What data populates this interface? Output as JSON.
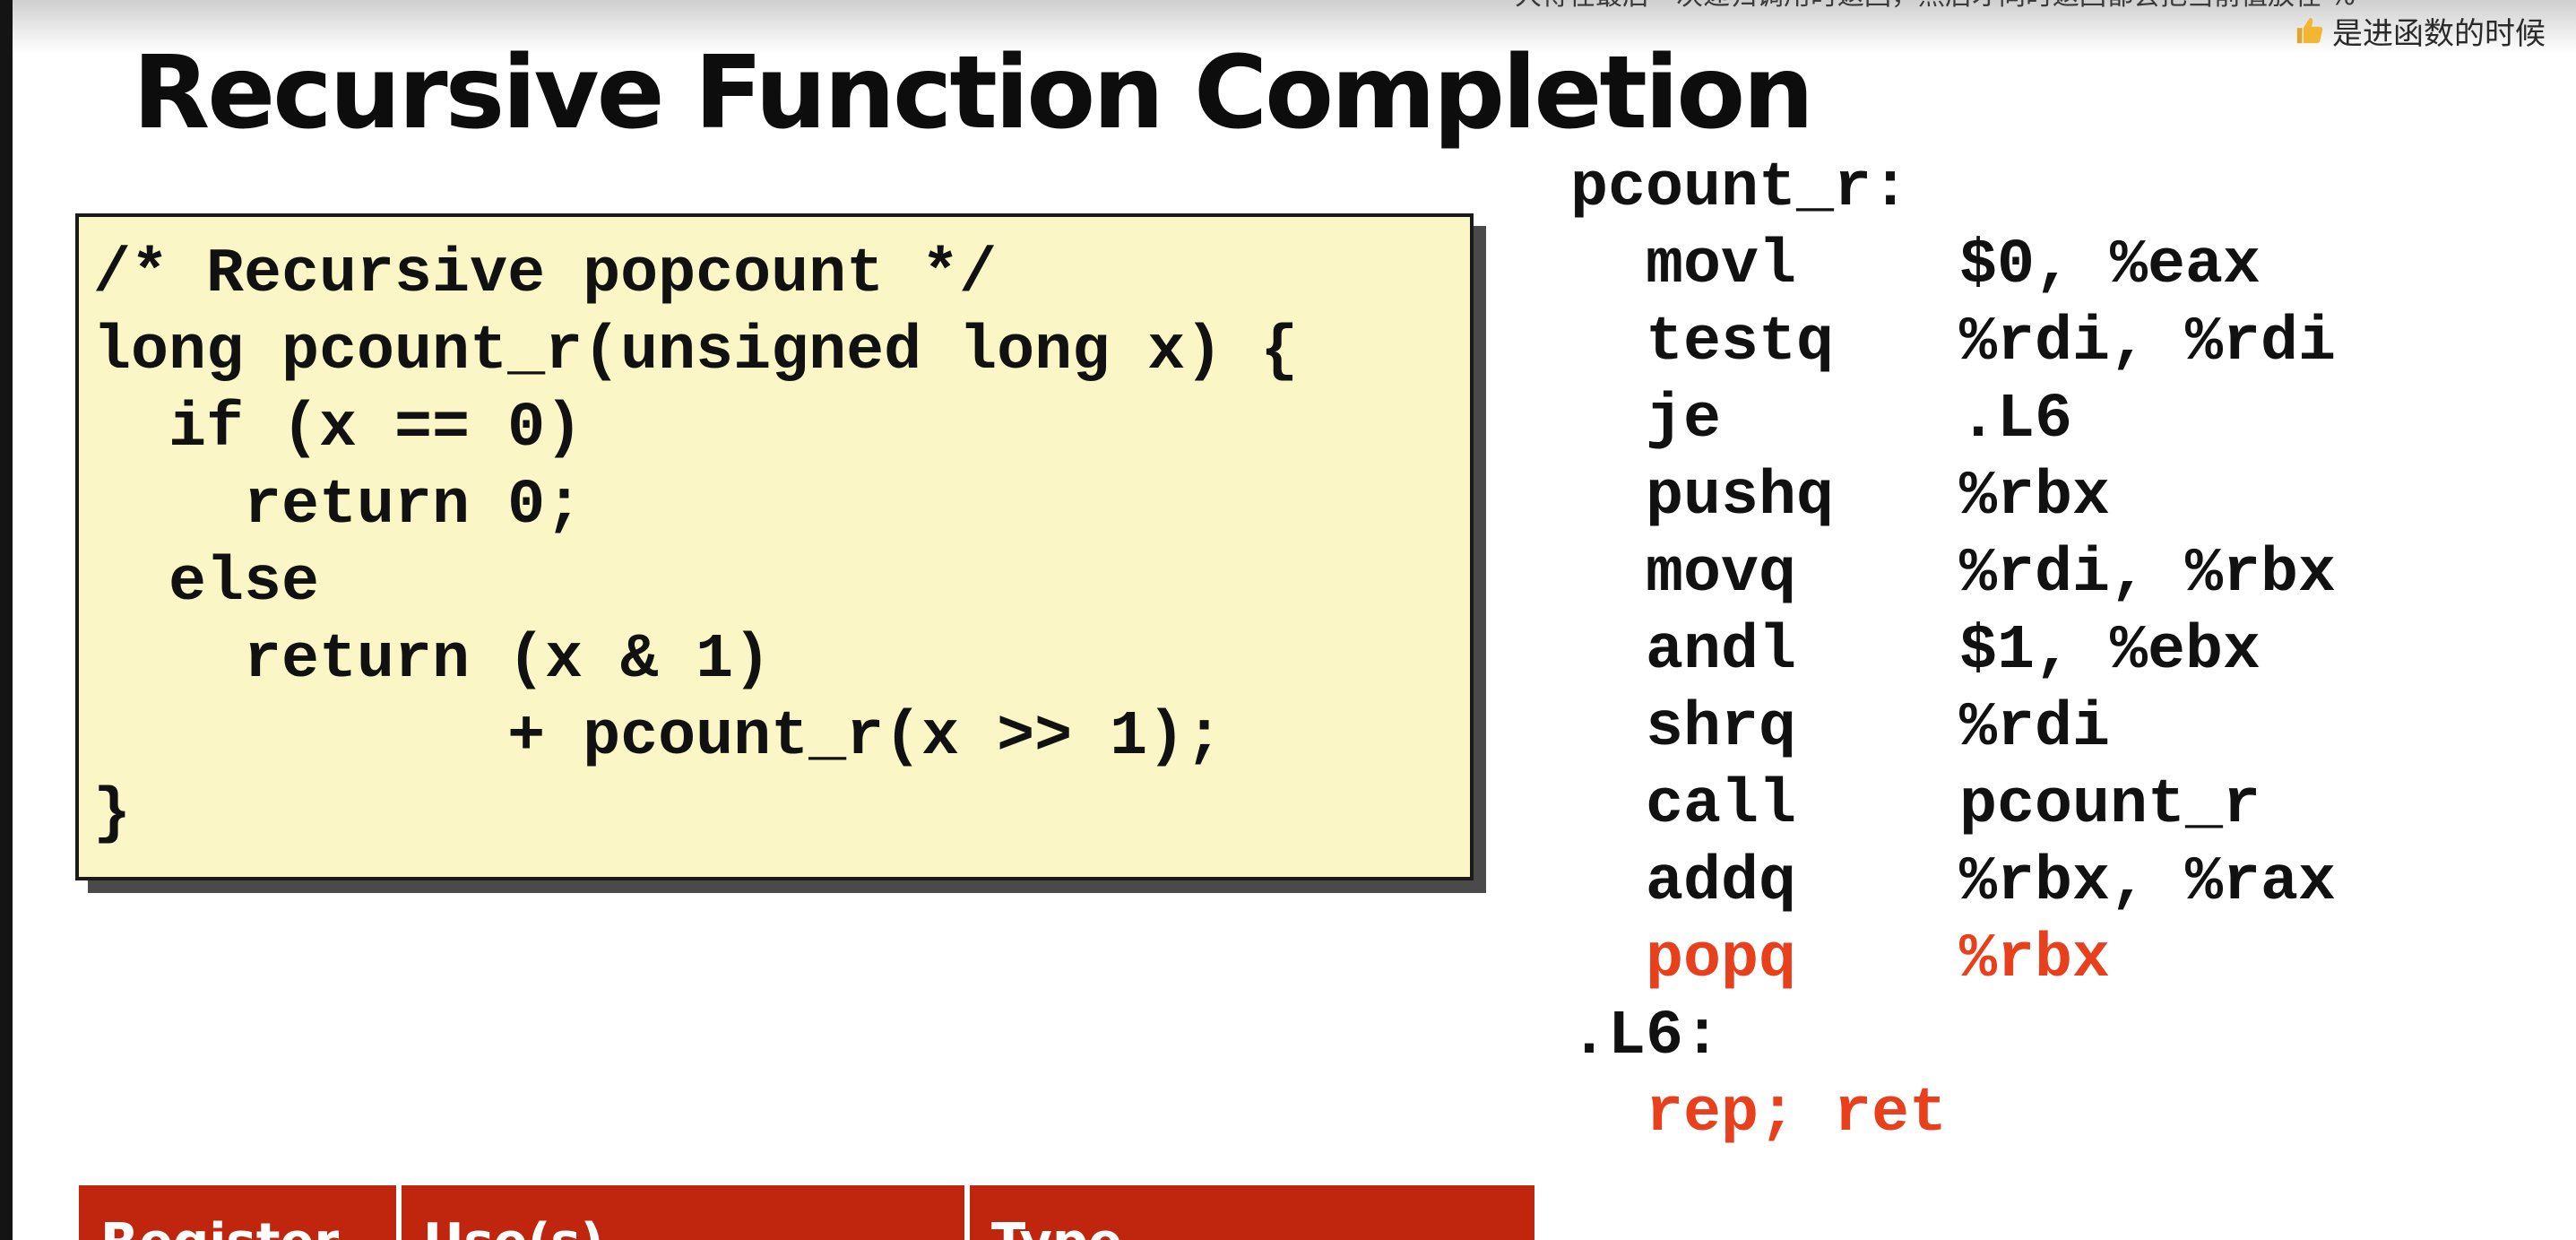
{
  "danmaku": {
    "top_line": "大得在最后一次递归调用时返回，然后才同时返回都会把当前值放在 %",
    "bar_text": "是进函数的时候"
  },
  "slide": {
    "title": "Recursive Function Completion"
  },
  "c_code": {
    "lines": [
      "/* Recursive popcount */",
      "long pcount_r(unsigned long x) {",
      "  if (x == 0)",
      "    return 0;",
      "  else",
      "    return (x & 1)",
      "           + pcount_r(x >> 1);",
      "}"
    ]
  },
  "assembly": {
    "label_func": "pcount_r:",
    "instructions": [
      {
        "op": "movl",
        "args": "$0, %eax"
      },
      {
        "op": "testq",
        "args": "%rdi, %rdi"
      },
      {
        "op": "je",
        "args": ".L6"
      },
      {
        "op": "pushq",
        "args": "%rbx"
      },
      {
        "op": "movq",
        "args": "%rdi, %rbx"
      },
      {
        "op": "andl",
        "args": "$1, %ebx"
      },
      {
        "op": "shrq",
        "args": "%rdi"
      },
      {
        "op": "call",
        "args": "pcount_r"
      },
      {
        "op": "addq",
        "args": "%rbx, %rax"
      },
      {
        "op": "popq",
        "args": "%rbx"
      }
    ],
    "label_l6": ".L6:",
    "final_instruction": "rep; ret",
    "highlight_color": "#e8401c"
  },
  "register_table": {
    "headers": [
      "Register",
      "Use(s)",
      "Type"
    ],
    "header_color": "#c0250e"
  }
}
